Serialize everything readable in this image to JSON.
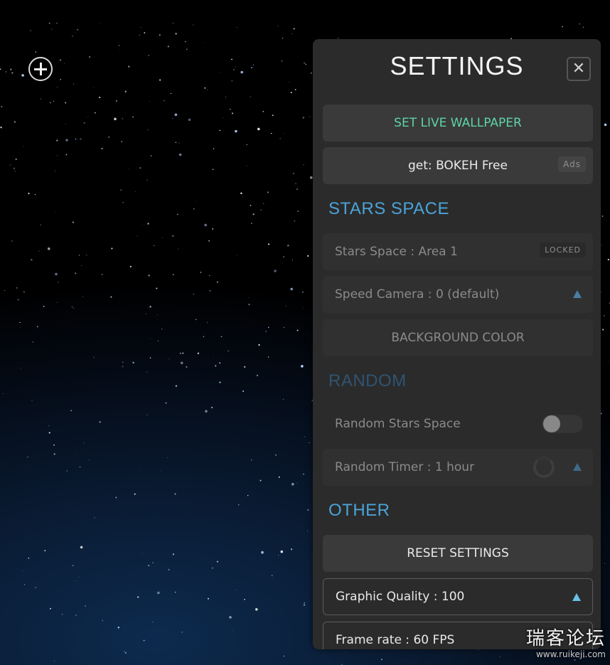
{
  "panel": {
    "title": "SETTINGS",
    "close_icon": "close-icon"
  },
  "buttons": {
    "set_live_wallpaper": "SET LIVE WALLPAPER",
    "get_bokeh": "get: BOKEH Free",
    "ads_tag": "Ads",
    "background_color": "BACKGROUND COLOR",
    "reset_settings": "RESET SETTINGS"
  },
  "sections": {
    "stars_space": "STARS SPACE",
    "random": "RANDOM",
    "other": "OTHER"
  },
  "rows": {
    "stars_space_area": "Stars Space : Area 1",
    "locked_tag": "LOCKED",
    "speed_camera": "Speed Camera : 0 (default)",
    "random_stars_space": "Random Stars Space",
    "random_timer": "Random Timer :  1 hour",
    "graphic_quality": "Graphic Quality : 100",
    "frame_rate": "Frame rate : 60 FPS"
  },
  "toggles": {
    "random_stars_space_on": false
  },
  "watermark": {
    "line1": "瑞客论坛",
    "line2": "www.ruikeji.com"
  },
  "colors": {
    "accent_blue": "#4aa3d8",
    "accent_green": "#5ed4a7",
    "panel_bg": "#2b2b2b"
  }
}
